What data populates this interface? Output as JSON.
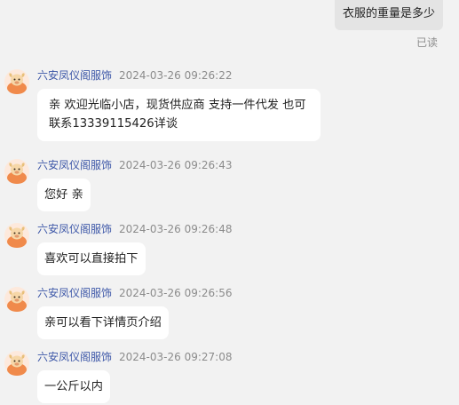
{
  "outgoing": {
    "text": "衣服的重量是多少",
    "status": "已读"
  },
  "messages": [
    {
      "sender": "六安凤仪阁服饰",
      "time": "2024-03-26 09:26:22",
      "text": "亲  欢迎光临小店，现货供应商   支持一件代发  也可联系13339115426详谈"
    },
    {
      "sender": "六安凤仪阁服饰",
      "time": "2024-03-26 09:26:43",
      "text": "您好  亲"
    },
    {
      "sender": "六安凤仪阁服饰",
      "time": "2024-03-26 09:26:48",
      "text": "喜欢可以直接拍下"
    },
    {
      "sender": "六安凤仪阁服饰",
      "time": "2024-03-26 09:26:56",
      "text": "亲可以看下详情页介绍"
    },
    {
      "sender": "六安凤仪阁服饰",
      "time": "2024-03-26 09:27:08",
      "text": "一公斤以内"
    }
  ],
  "colors": {
    "background": "#f2f2f2",
    "sender": "#3d57a8",
    "avatar_fill": "#f08a4b"
  },
  "avatar_icon": "shop-mascot-icon"
}
